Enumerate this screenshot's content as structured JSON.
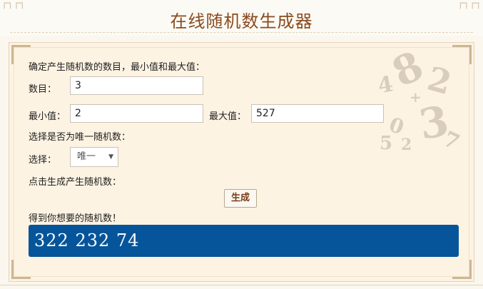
{
  "header": {
    "title": "在线随机数生成器"
  },
  "form": {
    "intro": "确定产生随机数的数目，最小值和最大值：",
    "count_label": "数目：",
    "count_value": "3",
    "min_label": "最小值：",
    "min_value": "2",
    "max_label": "最大值：",
    "max_value": "527",
    "unique_prompt": "选择是否为唯一随机数：",
    "select_label": "选择：",
    "select_value": "唯一",
    "generate_prompt": "点击生成产生随机数：",
    "generate_button": "生成",
    "result_prompt": "得到你想要的随机数！",
    "result_value": "322  232  74"
  },
  "colors": {
    "title": "#8a4b1f",
    "panel_bg": "#fdf3e3",
    "result_bg": "#06559a",
    "button_text": "#7a3c12"
  }
}
